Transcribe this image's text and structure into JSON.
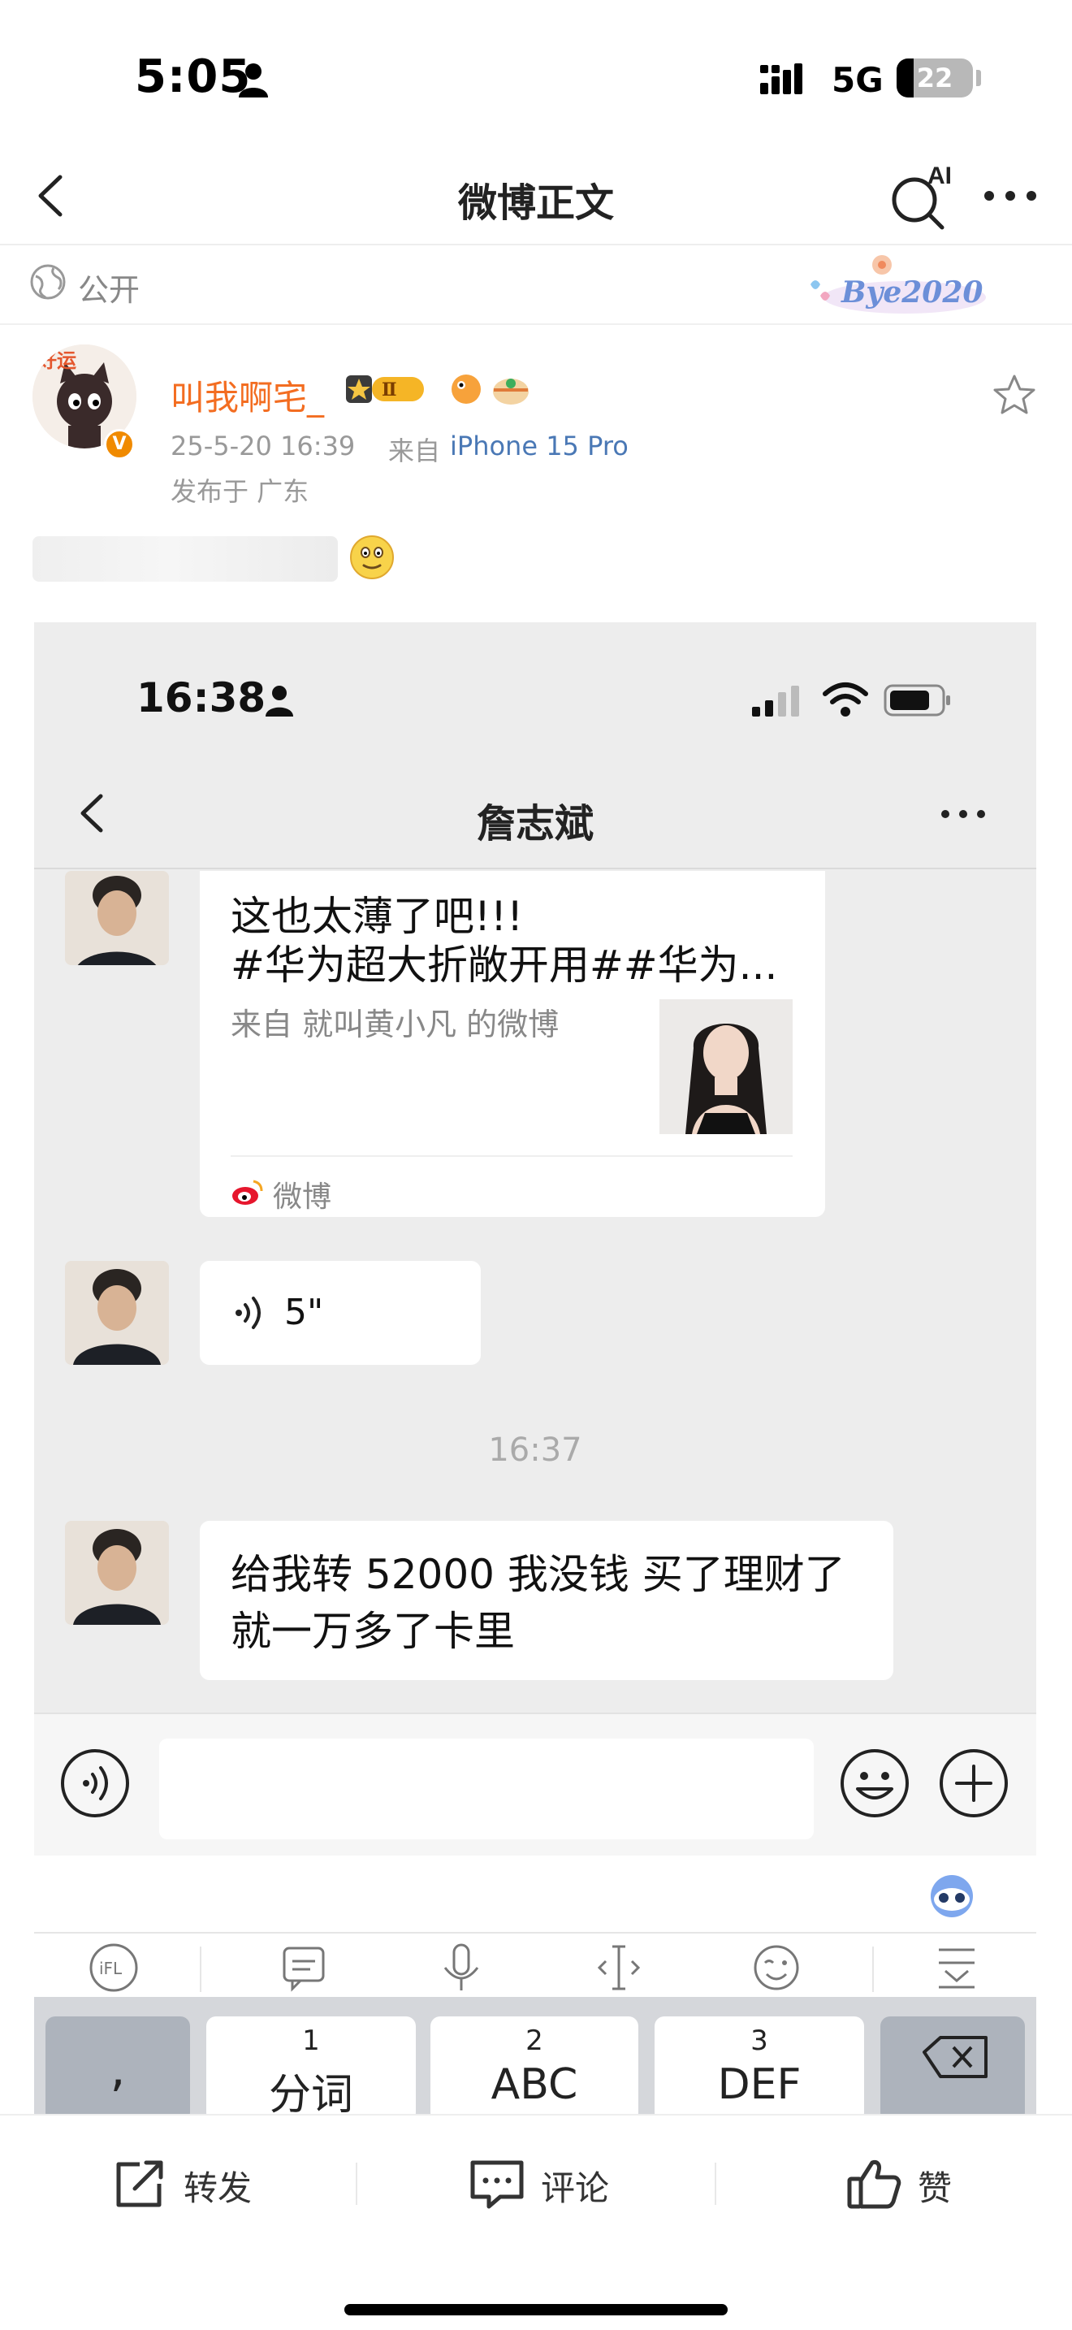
{
  "status_bar": {
    "time": "5:05",
    "network": "5G",
    "battery_level": "22",
    "battery_fraction": 0.22
  },
  "nav": {
    "title": "微博正文",
    "ai_label": "AI"
  },
  "visibility": {
    "label": "公开",
    "badge_text": "Bye2020"
  },
  "post": {
    "username": "叫我啊宅_",
    "level_badge": "Ⅱ",
    "avatar_text": "好运",
    "verified_label": "V",
    "date": "25-5-20 16:39",
    "source_prefix": "来自",
    "device": "iPhone 15 Pro",
    "location": "发布于 广东"
  },
  "screenshot": {
    "status_time": "16:38",
    "chat_title": "詹志斌",
    "shared_card": {
      "line1": "这也太薄了吧!!!",
      "line2": "#华为超大折敞开用##华为...",
      "from": "来自 就叫黄小凡 的微博",
      "brand": "微博"
    },
    "voice_message": "5\"",
    "timestamp": "16:37",
    "message_lines": [
      "给我转 52000 我没钱 买了理财了",
      "就一万多了卡里"
    ],
    "keyboard": {
      "punct_key": ",",
      "keys": [
        {
          "num": "1",
          "letters": "分词"
        },
        {
          "num": "2",
          "letters": "ABC"
        },
        {
          "num": "3",
          "letters": "DEF"
        }
      ]
    }
  },
  "actions": {
    "repost": "转发",
    "comment": "评论",
    "like": "赞"
  },
  "colors": {
    "username": "#f36d21",
    "device_link": "#4a78b5",
    "verified_badge": "#f08a00",
    "chat_background": "#ededed",
    "weibo_red": "#e6162d"
  },
  "icons": [
    "person-icon",
    "signal-icon",
    "back-arrow-icon",
    "ai-search-icon",
    "more-icon",
    "globe-icon",
    "star-icon",
    "smiley-icon",
    "wifi-icon",
    "battery-icon",
    "voice-wave-icon",
    "emoji-icon",
    "plus-icon",
    "keyboard-bot-icon",
    "repost-icon",
    "comment-icon",
    "like-icon"
  ]
}
